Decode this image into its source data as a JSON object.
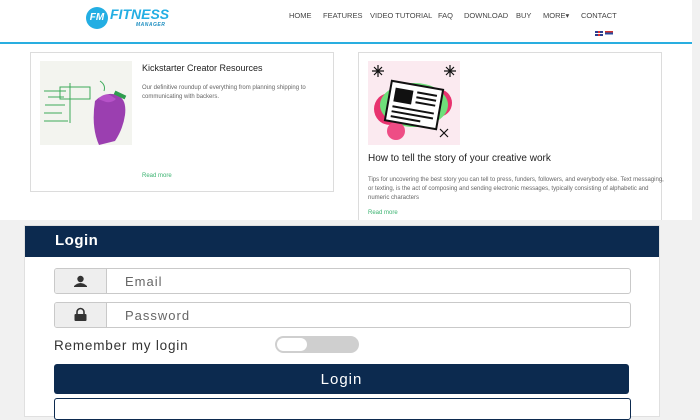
{
  "header": {
    "logo": {
      "badge": "FM",
      "name": "FITNESS",
      "sub": "MANAGER"
    },
    "nav": [
      "HOME",
      "FEATURES",
      "VIDEO TUTORIAL",
      "FAQ",
      "DOWNLOAD",
      "BUY",
      "MORE▾",
      "CONTACT"
    ],
    "languages": [
      "uk-flag-icon",
      "serbia-flag-icon"
    ]
  },
  "articles": [
    {
      "title": "Kickstarter Creator Resources",
      "text": "Our definitive roundup of everything from planning shipping to communicating with backers.",
      "read_more": "Read more",
      "image": "whiteboard-photo"
    },
    {
      "title": "How to tell the story of your creative work",
      "text": "Tips for uncovering the best story you can tell to press, funders, followers, and everybody else. Text messaging, or texting, is the act of composing and sending electronic messages, typically consisting of alphabetic and numeric characters",
      "read_more": "Read more",
      "image": "newspaper-illustration"
    }
  ],
  "login": {
    "title": "Login",
    "email_placeholder": "Email",
    "password_placeholder": "Password",
    "remember_label": "Remember my login",
    "remember_checked": false,
    "button_label": "Login",
    "icons": {
      "email": "user-icon",
      "password": "lock-icon"
    }
  },
  "colors": {
    "accent": "#29aee0",
    "navy": "#0c2a4f",
    "link": "#3cb371"
  }
}
